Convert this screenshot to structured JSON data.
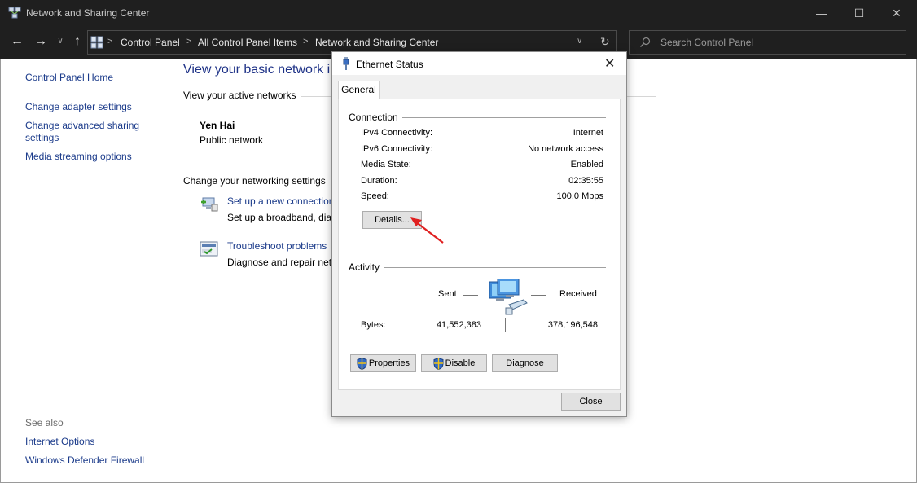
{
  "window": {
    "title": "Network and Sharing Center",
    "controls": {
      "minimize": "—",
      "maximize": "☐",
      "close": "✕"
    }
  },
  "address": {
    "breadcrumbs": [
      "Control Panel",
      "All Control Panel Items",
      "Network and Sharing Center"
    ],
    "separator": ">",
    "search_placeholder": "Search Control Panel"
  },
  "sidebar": {
    "home": "Control Panel Home",
    "links": [
      "Change adapter settings",
      "Change advanced sharing",
      "settings",
      "Media streaming options"
    ],
    "see_also_heading": "See also",
    "see_also": [
      "Internet Options",
      "Windows Defender Firewall"
    ]
  },
  "main": {
    "heading": "View your basic network in",
    "active_networks_label": "View your active networks",
    "network_name": "Yen Hai",
    "network_type": "Public network",
    "change_settings_label": "Change your networking settings",
    "tasks": [
      {
        "link": "Set up a new connection",
        "desc": "Set up a broadband, dial"
      },
      {
        "link": "Troubleshoot problems",
        "desc": "Diagnose and repair netv"
      }
    ]
  },
  "dialog": {
    "title": "Ethernet Status",
    "tab": "General",
    "connection_label": "Connection",
    "properties": [
      {
        "label": "IPv4 Connectivity:",
        "value": "Internet"
      },
      {
        "label": "IPv6 Connectivity:",
        "value": "No network access"
      },
      {
        "label": "Media State:",
        "value": "Enabled"
      },
      {
        "label": "Duration:",
        "value": "02:35:55"
      },
      {
        "label": "Speed:",
        "value": "100.0 Mbps"
      }
    ],
    "details_button": "Details...",
    "activity_label": "Activity",
    "sent_label": "Sent",
    "received_label": "Received",
    "bytes_label": "Bytes:",
    "bytes_sent": "41,552,383",
    "bytes_received": "378,196,548",
    "buttons": {
      "properties": "Properties",
      "disable": "Disable",
      "diagnose": "Diagnose",
      "close": "Close"
    }
  },
  "colors": {
    "link": "#1a3a8a",
    "heading": "#1e3287",
    "annotation_arrow": "#e02020"
  },
  "icons": [
    "control-panel-icon",
    "back-arrow-icon",
    "forward-arrow-icon",
    "up-arrow-icon",
    "refresh-icon",
    "search-icon",
    "ethernet-icon",
    "network-computers-icon",
    "uac-shield-icon",
    "setup-connection-icon",
    "troubleshoot-icon"
  ]
}
